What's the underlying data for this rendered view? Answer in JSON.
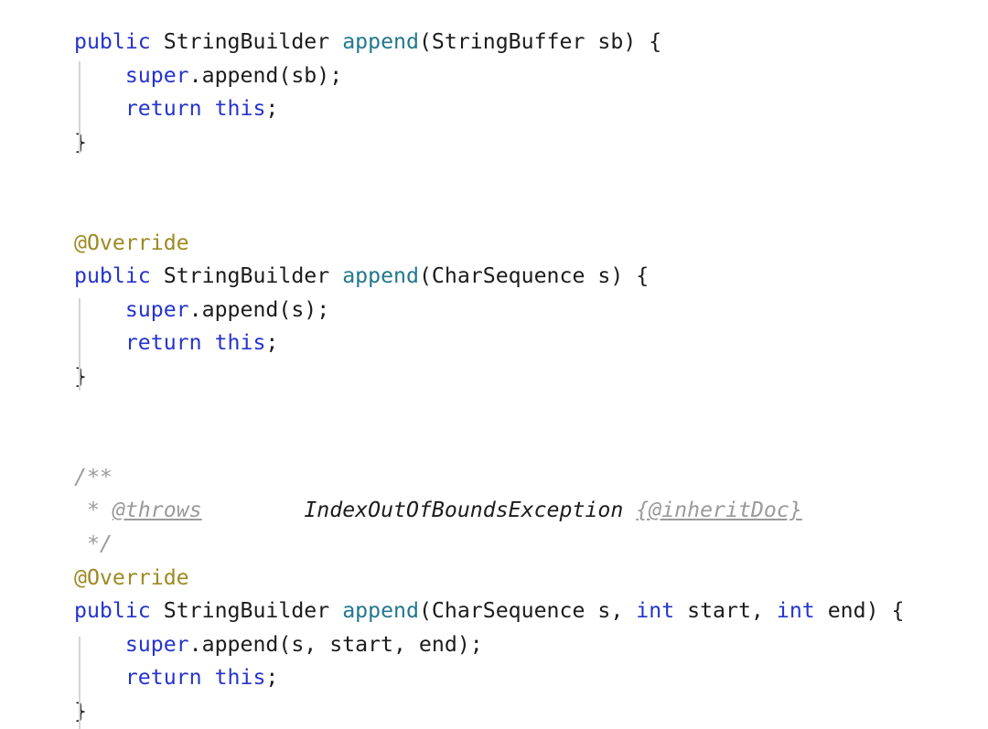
{
  "editor": {
    "language": "Java",
    "background_color": "#ffffff",
    "font_size_px": 23,
    "line_height_px": 37
  },
  "colors": {
    "keyword": "#2534cc",
    "plain_text": "#1c1c1c",
    "method_name": "#23788c",
    "annotation": "#9c8a22",
    "comment": "#9a9a9a",
    "comment_emphasis": "#1c1c1c",
    "indent_guide": "#d4d4d4"
  },
  "code": {
    "lines": [
      {
        "n": 1,
        "text": "public StringBuilder append(StringBuffer sb) {",
        "tokens": [
          {
            "t": "public",
            "k": "keyword"
          },
          {
            "t": " ",
            "k": "plain"
          },
          {
            "t": "StringBuilder",
            "k": "plain"
          },
          {
            "t": " ",
            "k": "plain"
          },
          {
            "t": "append",
            "k": "method"
          },
          {
            "t": "(StringBuffer sb) {",
            "k": "plain"
          }
        ]
      },
      {
        "n": 2,
        "text": "    super.append(sb);",
        "tokens": [
          {
            "t": "    ",
            "k": "plain"
          },
          {
            "t": "super",
            "k": "keyword"
          },
          {
            "t": ".append(sb);",
            "k": "plain"
          }
        ]
      },
      {
        "n": 3,
        "text": "    return this;",
        "tokens": [
          {
            "t": "    ",
            "k": "plain"
          },
          {
            "t": "return",
            "k": "keyword"
          },
          {
            "t": " ",
            "k": "plain"
          },
          {
            "t": "this",
            "k": "keyword"
          },
          {
            "t": ";",
            "k": "plain"
          }
        ]
      },
      {
        "n": 4,
        "text": "}",
        "tokens": [
          {
            "t": "}",
            "k": "plain"
          }
        ]
      },
      {
        "n": 5,
        "text": "",
        "tokens": []
      },
      {
        "n": 6,
        "text": "",
        "tokens": []
      },
      {
        "n": 7,
        "text": "@Override",
        "tokens": [
          {
            "t": "@Override",
            "k": "annot"
          }
        ]
      },
      {
        "n": 8,
        "text": "public StringBuilder append(CharSequence s) {",
        "tokens": [
          {
            "t": "public",
            "k": "keyword"
          },
          {
            "t": " ",
            "k": "plain"
          },
          {
            "t": "StringBuilder",
            "k": "plain"
          },
          {
            "t": " ",
            "k": "plain"
          },
          {
            "t": "append",
            "k": "method"
          },
          {
            "t": "(CharSequence s) {",
            "k": "plain"
          }
        ]
      },
      {
        "n": 9,
        "text": "    super.append(s);",
        "tokens": [
          {
            "t": "    ",
            "k": "plain"
          },
          {
            "t": "super",
            "k": "keyword"
          },
          {
            "t": ".append(s);",
            "k": "plain"
          }
        ]
      },
      {
        "n": 10,
        "text": "    return this;",
        "tokens": [
          {
            "t": "    ",
            "k": "plain"
          },
          {
            "t": "return",
            "k": "keyword"
          },
          {
            "t": " ",
            "k": "plain"
          },
          {
            "t": "this",
            "k": "keyword"
          },
          {
            "t": ";",
            "k": "plain"
          }
        ]
      },
      {
        "n": 11,
        "text": "}",
        "tokens": [
          {
            "t": "}",
            "k": "plain"
          }
        ]
      },
      {
        "n": 12,
        "text": "",
        "tokens": []
      },
      {
        "n": 13,
        "text": "",
        "tokens": []
      },
      {
        "n": 14,
        "text": "/**",
        "tokens": [
          {
            "t": "/**",
            "k": "comment"
          }
        ]
      },
      {
        "n": 15,
        "text": " * @throws        IndexOutOfBoundsException {@inheritDoc}",
        "tokens": [
          {
            "t": " * ",
            "k": "comment"
          },
          {
            "t": "@throws",
            "k": "comment-tag"
          },
          {
            "t": "        ",
            "k": "comment"
          },
          {
            "t": "IndexOutOfBoundsException",
            "k": "comment-strong"
          },
          {
            "t": " ",
            "k": "comment"
          },
          {
            "t": "{@inheritDoc}",
            "k": "comment-tag"
          }
        ]
      },
      {
        "n": 16,
        "text": " */",
        "tokens": [
          {
            "t": " */",
            "k": "comment"
          }
        ]
      },
      {
        "n": 17,
        "text": "@Override",
        "tokens": [
          {
            "t": "@Override",
            "k": "annot"
          }
        ]
      },
      {
        "n": 18,
        "text": "public StringBuilder append(CharSequence s, int start, int end) {",
        "tokens": [
          {
            "t": "public",
            "k": "keyword"
          },
          {
            "t": " ",
            "k": "plain"
          },
          {
            "t": "StringBuilder",
            "k": "plain"
          },
          {
            "t": " ",
            "k": "plain"
          },
          {
            "t": "append",
            "k": "method"
          },
          {
            "t": "(CharSequence s, ",
            "k": "plain"
          },
          {
            "t": "int",
            "k": "keyword"
          },
          {
            "t": " start, ",
            "k": "plain"
          },
          {
            "t": "int",
            "k": "keyword"
          },
          {
            "t": " end) {",
            "k": "plain"
          }
        ]
      },
      {
        "n": 19,
        "text": "    super.append(s, start, end);",
        "tokens": [
          {
            "t": "    ",
            "k": "plain"
          },
          {
            "t": "super",
            "k": "keyword"
          },
          {
            "t": ".append(s, start, end);",
            "k": "plain"
          }
        ]
      },
      {
        "n": 20,
        "text": "    return this;",
        "tokens": [
          {
            "t": "    ",
            "k": "plain"
          },
          {
            "t": "return",
            "k": "keyword"
          },
          {
            "t": " ",
            "k": "plain"
          },
          {
            "t": "this",
            "k": "keyword"
          },
          {
            "t": ";",
            "k": "plain"
          }
        ]
      },
      {
        "n": 21,
        "text": "}",
        "tokens": [
          {
            "t": "}",
            "k": "plain"
          }
        ]
      }
    ]
  },
  "indent_guides": [
    {
      "after_line": 1,
      "span_lines": 3
    },
    {
      "after_line": 8,
      "span_lines": 3
    },
    {
      "after_line": 18,
      "span_lines": 3
    }
  ]
}
